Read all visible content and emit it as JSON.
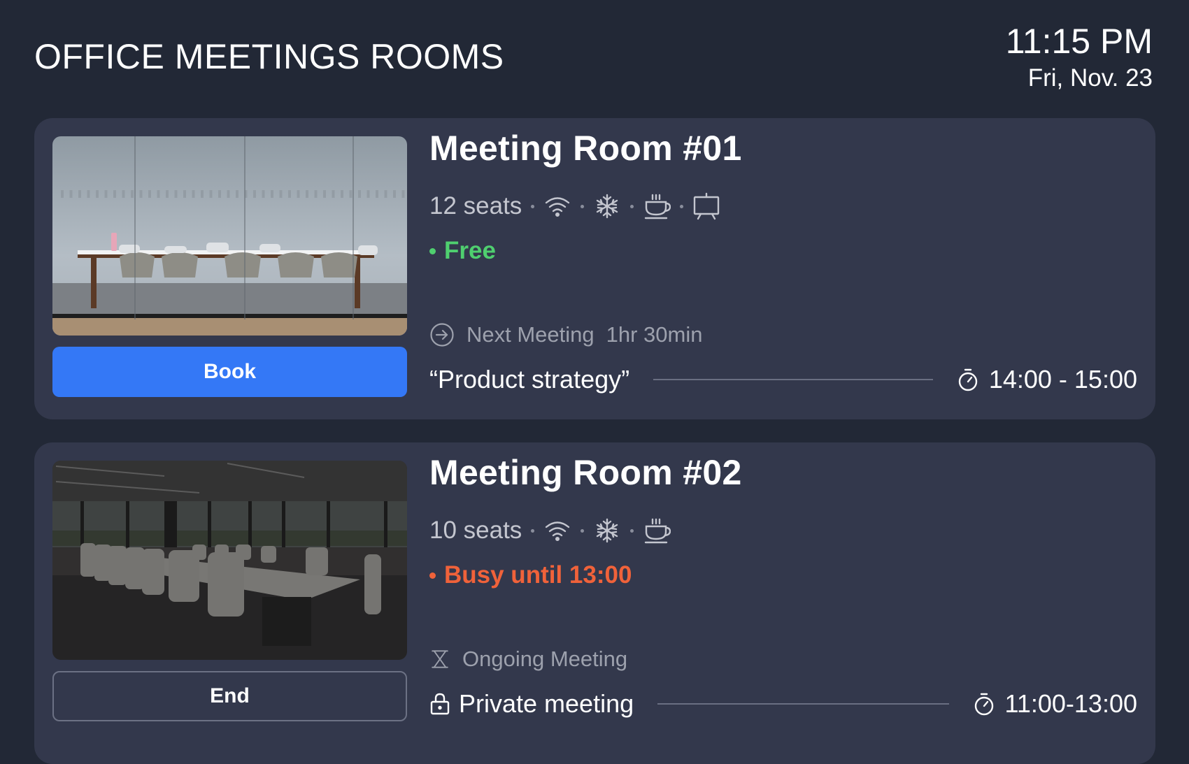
{
  "header": {
    "title": "OFFICE MEETINGS ROOMS",
    "time": "11:15 PM",
    "date": "Fri, Nov. 23"
  },
  "colors": {
    "background": "#222836",
    "card": "#33384c",
    "accent_blue": "#3478f6",
    "status_free": "#4fcf6f",
    "status_busy": "#f0623a"
  },
  "rooms": [
    {
      "name": "Meeting Room #01",
      "seats": "12 seats",
      "amenities": [
        "wifi-icon",
        "snowflake-icon",
        "coffee-cup-icon",
        "presentation-board-icon"
      ],
      "status": "Free",
      "status_type": "free",
      "meeting_label": "Next Meeting",
      "meeting_countdown": "1hr 30min",
      "meeting_label_icon": "arrow-circle-right-icon",
      "meeting_title": "“Product strategy”",
      "meeting_time": "14:00 - 15:00",
      "action_label": "Book"
    },
    {
      "name": "Meeting Room #02",
      "seats": "10 seats",
      "amenities": [
        "wifi-icon",
        "snowflake-icon",
        "coffee-cup-icon"
      ],
      "status": "Busy until 13:00",
      "status_type": "busy",
      "meeting_label": "Ongoing Meeting",
      "meeting_label_icon": "hourglass-icon",
      "meeting_title": "Private meeting",
      "meeting_title_icon": "lock-icon",
      "meeting_time": "11:00-13:00",
      "action_label": "End"
    }
  ]
}
